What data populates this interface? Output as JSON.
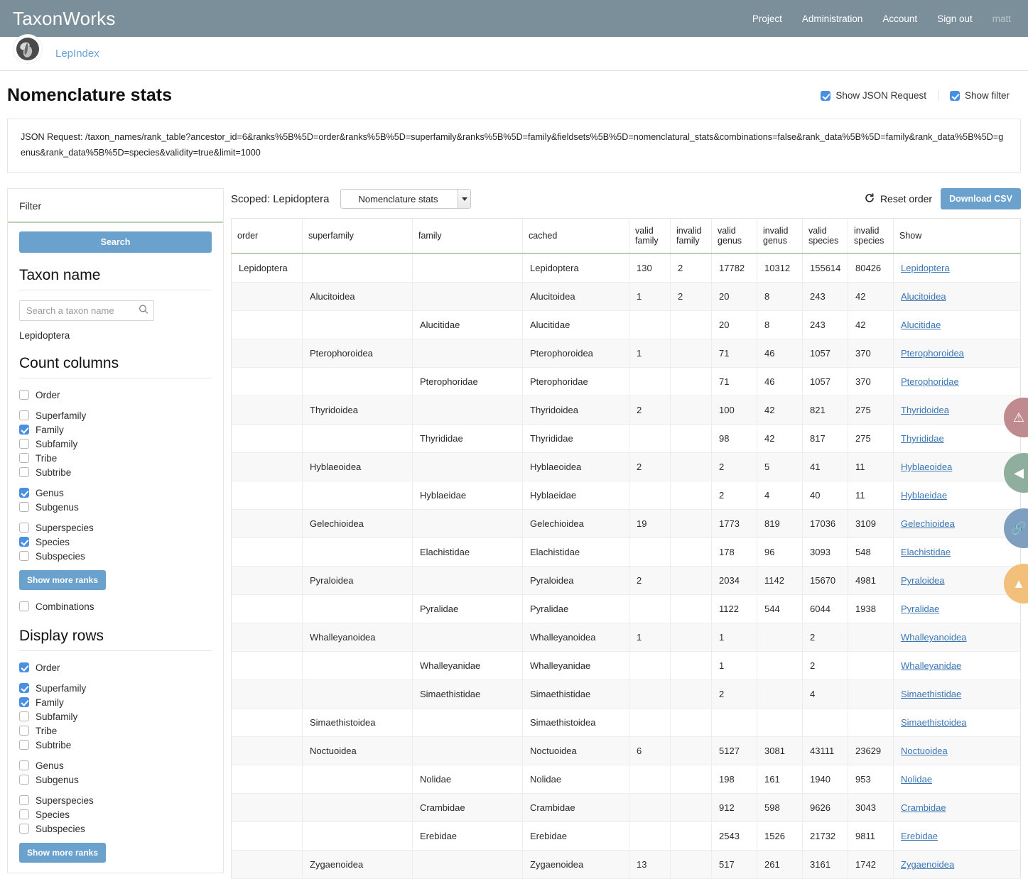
{
  "navbar": {
    "brand": "TaxonWorks",
    "links": [
      {
        "label": "Project",
        "name": "nav-project"
      },
      {
        "label": "Administration",
        "name": "nav-administration"
      },
      {
        "label": "Account",
        "name": "nav-account"
      },
      {
        "label": "Sign out",
        "name": "nav-sign-out"
      }
    ],
    "user": "matt"
  },
  "project_bar": {
    "logo_icon": "moth-logo-icon",
    "project_name": "LepIndex"
  },
  "page": {
    "title": "Nomenclature stats",
    "show_json_request_label": "Show JSON Request",
    "show_json_request_checked": true,
    "show_filter_label": "Show filter",
    "show_filter_checked": true,
    "json_request": "JSON Request: /taxon_names/rank_table?ancestor_id=6&ranks%5B%5D=order&ranks%5B%5D=superfamily&ranks%5B%5D=family&fieldsets%5B%5D=nomenclatural_stats&combinations=false&rank_data%5B%5D=family&rank_data%5B%5D=genus&rank_data%5B%5D=species&validity=true&limit=1000"
  },
  "sidebar": {
    "header": "Filter",
    "search_button": "Search",
    "taxon_name_title": "Taxon name",
    "taxon_search_placeholder": "Search a taxon name",
    "taxon_search_value": "",
    "search_icon": "search-icon",
    "scoped_taxon": "Lepidoptera",
    "count_columns_title": "Count columns",
    "count_columns": [
      {
        "label": "Order",
        "checked": false,
        "gap": false
      },
      {
        "label": "Superfamily",
        "checked": false,
        "gap": true
      },
      {
        "label": "Family",
        "checked": true,
        "gap": false
      },
      {
        "label": "Subfamily",
        "checked": false,
        "gap": false
      },
      {
        "label": "Tribe",
        "checked": false,
        "gap": false
      },
      {
        "label": "Subtribe",
        "checked": false,
        "gap": false
      },
      {
        "label": "Genus",
        "checked": true,
        "gap": true
      },
      {
        "label": "Subgenus",
        "checked": false,
        "gap": false
      },
      {
        "label": "Superspecies",
        "checked": false,
        "gap": true
      },
      {
        "label": "Species",
        "checked": true,
        "gap": false
      },
      {
        "label": "Subspecies",
        "checked": false,
        "gap": false
      }
    ],
    "count_more_button": "Show more ranks",
    "combinations": {
      "label": "Combinations",
      "checked": false
    },
    "display_rows_title": "Display rows",
    "display_rows": [
      {
        "label": "Order",
        "checked": true,
        "gap": false
      },
      {
        "label": "Superfamily",
        "checked": true,
        "gap": true
      },
      {
        "label": "Family",
        "checked": true,
        "gap": false
      },
      {
        "label": "Subfamily",
        "checked": false,
        "gap": false
      },
      {
        "label": "Tribe",
        "checked": false,
        "gap": false
      },
      {
        "label": "Subtribe",
        "checked": false,
        "gap": false
      },
      {
        "label": "Genus",
        "checked": false,
        "gap": true
      },
      {
        "label": "Subgenus",
        "checked": false,
        "gap": false
      },
      {
        "label": "Superspecies",
        "checked": false,
        "gap": true
      },
      {
        "label": "Species",
        "checked": false,
        "gap": false
      },
      {
        "label": "Subspecies",
        "checked": false,
        "gap": false
      }
    ],
    "display_more_button": "Show more ranks"
  },
  "toolbar": {
    "scoped_label": "Scoped: Lepidoptera",
    "view_select_value": "Nomenclature stats",
    "reset_order_label": "Reset order",
    "reset_icon": "refresh-icon",
    "download_csv_label": "Download CSV"
  },
  "table": {
    "columns": [
      "order",
      "superfamily",
      "family",
      "cached",
      "valid family",
      "invalid family",
      "valid genus",
      "invalid genus",
      "valid species",
      "invalid species",
      "Show"
    ],
    "rows": [
      {
        "order": "Lepidoptera",
        "superfamily": "",
        "family": "",
        "cached": "Lepidoptera",
        "valid_family": "130",
        "invalid_family": "2",
        "valid_genus": "17782",
        "invalid_genus": "10312",
        "valid_species": "155614",
        "invalid_species": "80426",
        "show": "Lepidoptera"
      },
      {
        "order": "",
        "superfamily": "Alucitoidea",
        "family": "",
        "cached": "Alucitoidea",
        "valid_family": "1",
        "invalid_family": "2",
        "valid_genus": "20",
        "invalid_genus": "8",
        "valid_species": "243",
        "invalid_species": "42",
        "show": "Alucitoidea"
      },
      {
        "order": "",
        "superfamily": "",
        "family": "Alucitidae",
        "cached": "Alucitidae",
        "valid_family": "",
        "invalid_family": "",
        "valid_genus": "20",
        "invalid_genus": "8",
        "valid_species": "243",
        "invalid_species": "42",
        "show": "Alucitidae"
      },
      {
        "order": "",
        "superfamily": "Pterophoroidea",
        "family": "",
        "cached": "Pterophoroidea",
        "valid_family": "1",
        "invalid_family": "",
        "valid_genus": "71",
        "invalid_genus": "46",
        "valid_species": "1057",
        "invalid_species": "370",
        "show": "Pterophoroidea"
      },
      {
        "order": "",
        "superfamily": "",
        "family": "Pterophoridae",
        "cached": "Pterophoridae",
        "valid_family": "",
        "invalid_family": "",
        "valid_genus": "71",
        "invalid_genus": "46",
        "valid_species": "1057",
        "invalid_species": "370",
        "show": "Pterophoridae"
      },
      {
        "order": "",
        "superfamily": "Thyridoidea",
        "family": "",
        "cached": "Thyridoidea",
        "valid_family": "2",
        "invalid_family": "",
        "valid_genus": "100",
        "invalid_genus": "42",
        "valid_species": "821",
        "invalid_species": "275",
        "show": "Thyridoidea"
      },
      {
        "order": "",
        "superfamily": "",
        "family": "Thyrididae",
        "cached": "Thyrididae",
        "valid_family": "",
        "invalid_family": "",
        "valid_genus": "98",
        "invalid_genus": "42",
        "valid_species": "817",
        "invalid_species": "275",
        "show": "Thyrididae"
      },
      {
        "order": "",
        "superfamily": "Hyblaeoidea",
        "family": "",
        "cached": "Hyblaeoidea",
        "valid_family": "2",
        "invalid_family": "",
        "valid_genus": "2",
        "invalid_genus": "5",
        "valid_species": "41",
        "invalid_species": "11",
        "show": "Hyblaeoidea"
      },
      {
        "order": "",
        "superfamily": "",
        "family": "Hyblaeidae",
        "cached": "Hyblaeidae",
        "valid_family": "",
        "invalid_family": "",
        "valid_genus": "2",
        "invalid_genus": "4",
        "valid_species": "40",
        "invalid_species": "11",
        "show": "Hyblaeidae"
      },
      {
        "order": "",
        "superfamily": "Gelechioidea",
        "family": "",
        "cached": "Gelechioidea",
        "valid_family": "19",
        "invalid_family": "",
        "valid_genus": "1773",
        "invalid_genus": "819",
        "valid_species": "17036",
        "invalid_species": "3109",
        "show": "Gelechioidea"
      },
      {
        "order": "",
        "superfamily": "",
        "family": "Elachistidae",
        "cached": "Elachistidae",
        "valid_family": "",
        "invalid_family": "",
        "valid_genus": "178",
        "invalid_genus": "96",
        "valid_species": "3093",
        "invalid_species": "548",
        "show": "Elachistidae"
      },
      {
        "order": "",
        "superfamily": "Pyraloidea",
        "family": "",
        "cached": "Pyraloidea",
        "valid_family": "2",
        "invalid_family": "",
        "valid_genus": "2034",
        "invalid_genus": "1142",
        "valid_species": "15670",
        "invalid_species": "4981",
        "show": "Pyraloidea"
      },
      {
        "order": "",
        "superfamily": "",
        "family": "Pyralidae",
        "cached": "Pyralidae",
        "valid_family": "",
        "invalid_family": "",
        "valid_genus": "1122",
        "invalid_genus": "544",
        "valid_species": "6044",
        "invalid_species": "1938",
        "show": "Pyralidae"
      },
      {
        "order": "",
        "superfamily": "Whalleyanoidea",
        "family": "",
        "cached": "Whalleyanoidea",
        "valid_family": "1",
        "invalid_family": "",
        "valid_genus": "1",
        "invalid_genus": "",
        "valid_species": "2",
        "invalid_species": "",
        "show": "Whalleyanoidea"
      },
      {
        "order": "",
        "superfamily": "",
        "family": "Whalleyanidae",
        "cached": "Whalleyanidae",
        "valid_family": "",
        "invalid_family": "",
        "valid_genus": "1",
        "invalid_genus": "",
        "valid_species": "2",
        "invalid_species": "",
        "show": "Whalleyanidae"
      },
      {
        "order": "",
        "superfamily": "",
        "family": "Simaethistidae",
        "cached": "Simaethistidae",
        "valid_family": "",
        "invalid_family": "",
        "valid_genus": "2",
        "invalid_genus": "",
        "valid_species": "4",
        "invalid_species": "",
        "show": "Simaethistidae"
      },
      {
        "order": "",
        "superfamily": "Simaethistoidea",
        "family": "",
        "cached": "Simaethistoidea",
        "valid_family": "",
        "invalid_family": "",
        "valid_genus": "",
        "invalid_genus": "",
        "valid_species": "",
        "invalid_species": "",
        "show": "Simaethistoidea"
      },
      {
        "order": "",
        "superfamily": "Noctuoidea",
        "family": "",
        "cached": "Noctuoidea",
        "valid_family": "6",
        "invalid_family": "",
        "valid_genus": "5127",
        "invalid_genus": "3081",
        "valid_species": "43111",
        "invalid_species": "23629",
        "show": "Noctuoidea"
      },
      {
        "order": "",
        "superfamily": "",
        "family": "Nolidae",
        "cached": "Nolidae",
        "valid_family": "",
        "invalid_family": "",
        "valid_genus": "198",
        "invalid_genus": "161",
        "valid_species": "1940",
        "invalid_species": "953",
        "show": "Nolidae"
      },
      {
        "order": "",
        "superfamily": "",
        "family": "Crambidae",
        "cached": "Crambidae",
        "valid_family": "",
        "invalid_family": "",
        "valid_genus": "912",
        "invalid_genus": "598",
        "valid_species": "9626",
        "invalid_species": "3043",
        "show": "Crambidae"
      },
      {
        "order": "",
        "superfamily": "",
        "family": "Erebidae",
        "cached": "Erebidae",
        "valid_family": "",
        "invalid_family": "",
        "valid_genus": "2543",
        "invalid_genus": "1526",
        "valid_species": "21732",
        "invalid_species": "9811",
        "show": "Erebidae"
      },
      {
        "order": "",
        "superfamily": "Zygaenoidea",
        "family": "",
        "cached": "Zygaenoidea",
        "valid_family": "13",
        "invalid_family": "",
        "valid_genus": "517",
        "invalid_genus": "261",
        "valid_species": "3161",
        "invalid_species": "1742",
        "show": "Zygaenoidea"
      }
    ]
  },
  "floating_actions": [
    {
      "name": "radial-warning-button",
      "icon": "warning-triangle-icon",
      "color": "#c08b8f",
      "glyph": "⚠"
    },
    {
      "name": "radial-back-button",
      "icon": "back-arrow-icon",
      "color": "#8fae9e",
      "glyph": "◀"
    },
    {
      "name": "radial-pin-button",
      "icon": "paperclip-icon",
      "color": "#7e9fbf",
      "glyph": "🔗"
    },
    {
      "name": "radial-up-button",
      "icon": "up-arrow-icon",
      "color": "#f2c07a",
      "glyph": "▲"
    }
  ]
}
